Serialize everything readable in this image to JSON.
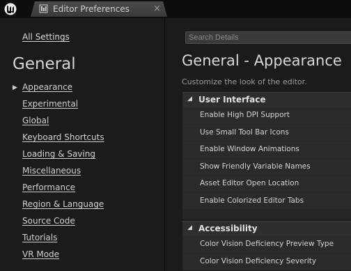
{
  "tab": {
    "title": "Editor Preferences",
    "close_glyph": "×",
    "icon": "preferences-icon"
  },
  "nav": {
    "all_settings": "All Settings",
    "heading": "General",
    "items": [
      {
        "label": "Appearance",
        "selected": true
      },
      {
        "label": "Experimental"
      },
      {
        "label": "Global"
      },
      {
        "label": "Keyboard Shortcuts"
      },
      {
        "label": "Loading & Saving"
      },
      {
        "label": "Miscellaneous"
      },
      {
        "label": "Performance"
      },
      {
        "label": "Region & Language"
      },
      {
        "label": "Source Code"
      },
      {
        "label": "Tutorials"
      },
      {
        "label": "VR Mode"
      }
    ]
  },
  "details": {
    "search_placeholder": "Search Details",
    "title": "General - Appearance",
    "subtitle": "Customize the look of the editor.",
    "sections": [
      {
        "name": "User Interface",
        "rows": [
          "Enable High DPI Support",
          "Use Small Tool Bar Icons",
          "Enable Window Animations",
          "Show Friendly Variable Names",
          "Asset Editor Open Location",
          "Enable Colorized Editor Tabs"
        ]
      },
      {
        "name": "Accessibility",
        "rows": [
          "Color Vision Deficiency Preview Type",
          "Color Vision Deficiency Severity"
        ]
      }
    ]
  },
  "colors": {
    "background": "#1b1b1b",
    "row": "#2a2a2a",
    "section_header": "#2e2e2e",
    "tab": "#444444"
  }
}
